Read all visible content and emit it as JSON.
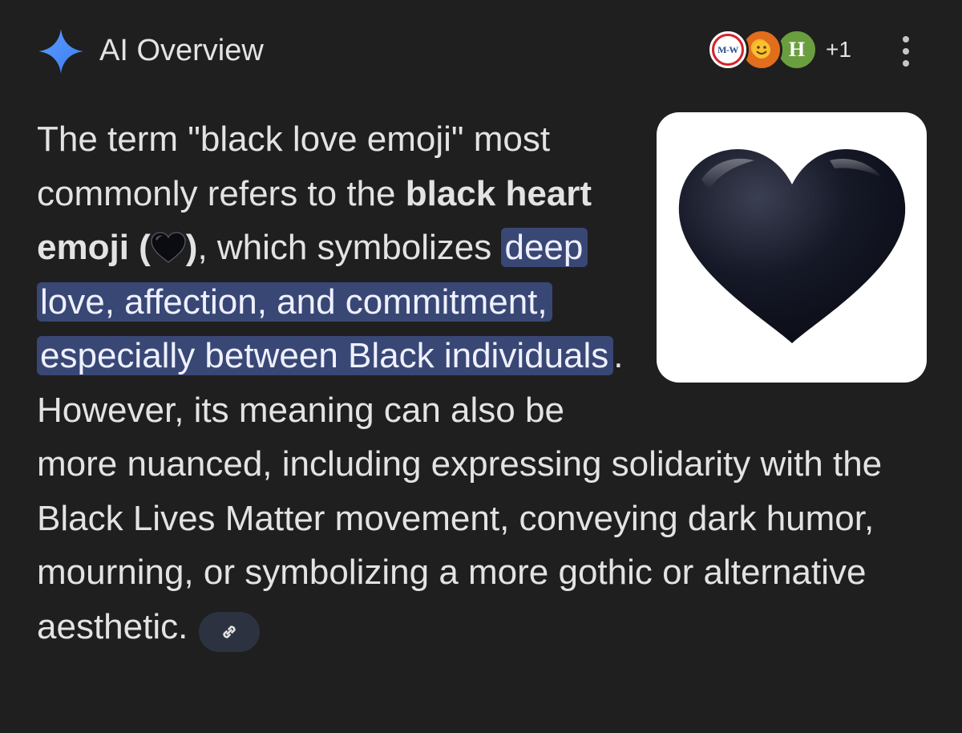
{
  "header": {
    "title": "AI Overview",
    "sparkle_icon": "sparkle-icon",
    "more_menu_icon": "more-vert-icon"
  },
  "sources": {
    "items": [
      {
        "name": "merriam-webster-source",
        "label": "M-W"
      },
      {
        "name": "emoji-source",
        "label": ""
      },
      {
        "name": "h-source",
        "label": "H"
      }
    ],
    "more_label": "+1"
  },
  "answer": {
    "t1": "The term \"black love emoji\" most commonly refers to the ",
    "bold": "black heart emoji (",
    "bold_close": ")",
    "t2": ", which symbolizes ",
    "highlight": "deep love, affection, and commitment, especially between Black individuals",
    "t3": ". However, its meaning can also be more nuanced, including expressing solidarity with the Black Lives Matter movement, conveying dark humor, mourning, or symbolizing a more gothic or alternative aesthetic.",
    "image_icon": "black-heart-icon",
    "link_icon": "link-icon"
  },
  "colors": {
    "background": "#1f1f1f",
    "text": "#e3e3e3",
    "highlight_bg": "#394775",
    "link_chip_bg": "#2d3241",
    "sparkle_blue": "#4c8df6"
  }
}
